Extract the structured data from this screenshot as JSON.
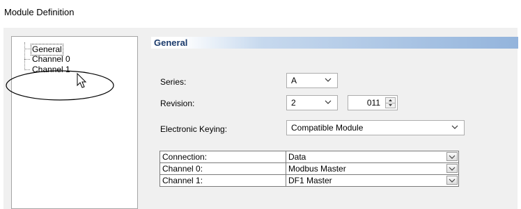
{
  "window": {
    "title": "Module Definition"
  },
  "tree": {
    "items": [
      {
        "label": "General",
        "selected": true
      },
      {
        "label": "Channel 0",
        "selected": false
      },
      {
        "label": "Channel 1",
        "selected": false
      }
    ]
  },
  "panel": {
    "header": "General",
    "series_label": "Series:",
    "series_value": "A",
    "revision_label": "Revision:",
    "revision_major": "2",
    "revision_minor": "011",
    "keying_label": "Electronic Keying:",
    "keying_value": "Compatible Module"
  },
  "table": {
    "rows": [
      {
        "label": "Connection:",
        "value": "Data"
      },
      {
        "label": "Channel 0:",
        "value": "Modbus Master"
      },
      {
        "label": "Channel 1:",
        "value": "DF1 Master"
      }
    ]
  },
  "icons": [
    "chevron-down-icon",
    "spin-up-icon",
    "spin-down-icon",
    "mouse-pointer-icon"
  ]
}
